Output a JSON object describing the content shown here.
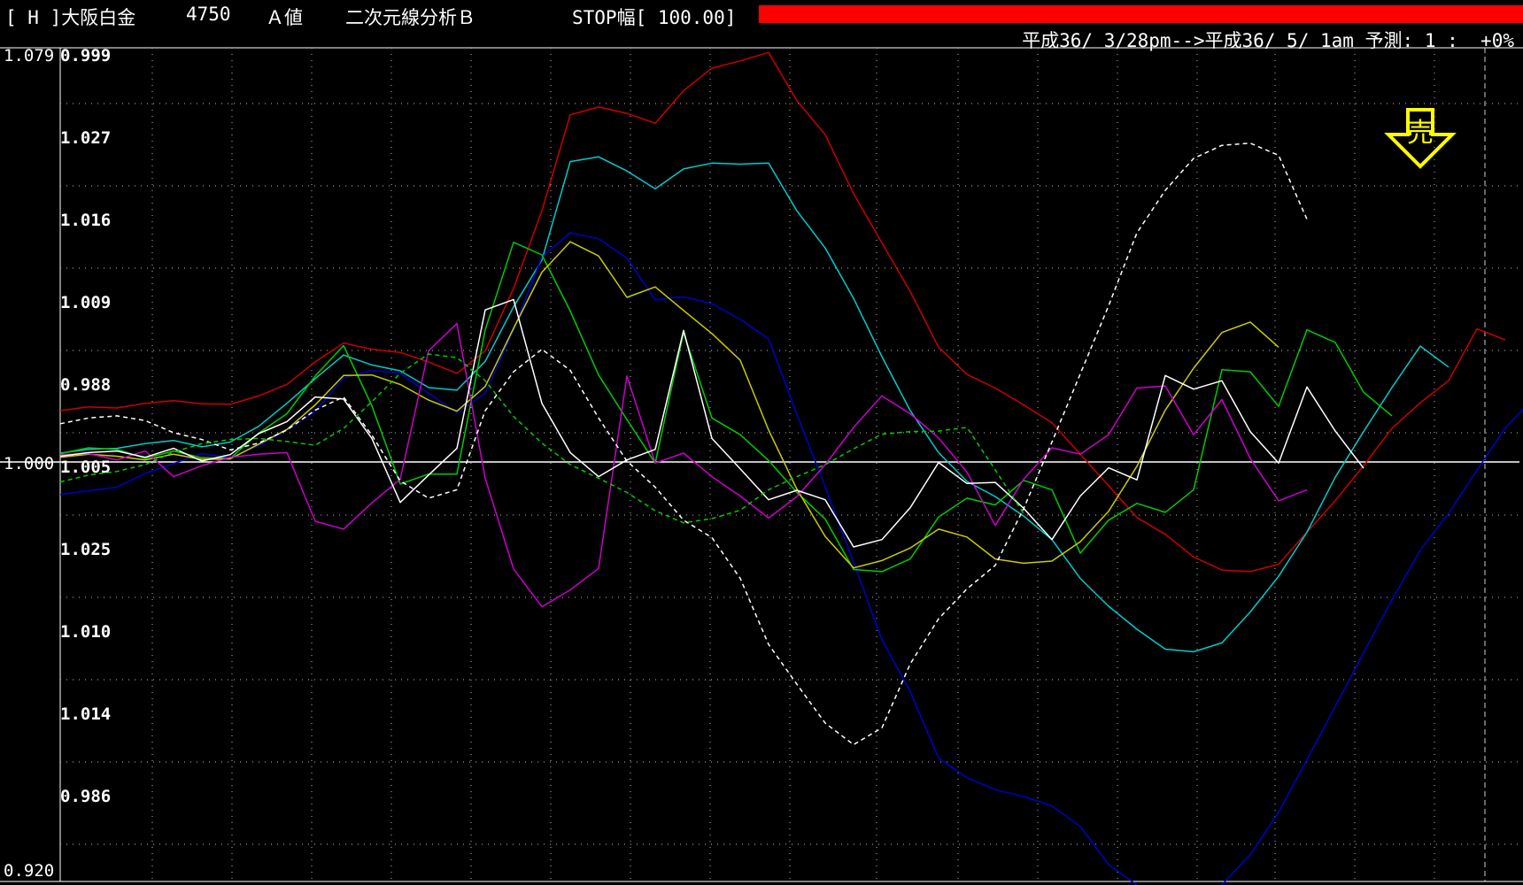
{
  "header": {
    "symbol": "[ H ]大阪白金",
    "price": "4750",
    "mode": "Ａ値",
    "analysis": "二次元線分析Ｂ",
    "stop": "STOP幅[ 100.00]",
    "colors": {
      "stop_bar": "#ff0000"
    }
  },
  "subheader": {
    "period": "平成36/ 3/28pm-->平成36/ 5/ 1am 予測: 1 :  +0%"
  },
  "chart_data": {
    "type": "line",
    "left_axis": {
      "top": "1.079",
      "mid": "1.000",
      "bottom": "0.920"
    },
    "right_labels": [
      "0.999",
      "1.027",
      "1.016",
      "1.009",
      "0.988",
      "1.005",
      "1.025",
      "1.010",
      "1.014",
      "0.986"
    ],
    "signal": {
      "glyph": "売",
      "meaning": "sell",
      "color": "#ffff00"
    },
    "baseline": 1.0,
    "y_range": [
      0.92,
      1.079
    ],
    "series": [
      {
        "color": "#cc0000",
        "style": "solid",
        "values": [
          1.0098,
          1.0105,
          1.0103,
          1.0112,
          1.0117,
          1.0111,
          1.011,
          1.0126,
          1.0148,
          1.0191,
          1.0227,
          1.0215,
          1.0209,
          1.0191,
          1.0169,
          1.0212,
          1.0331,
          1.0479,
          1.0662,
          1.0677,
          1.0665,
          1.0646,
          1.0708,
          1.0751,
          1.0765,
          1.0781,
          1.0689,
          1.0624,
          1.0512,
          1.0418,
          1.0325,
          1.0219,
          1.0167,
          1.0141,
          1.0109,
          1.0075,
          1.0015,
          0.9955,
          0.9894,
          0.9862,
          0.9819,
          0.9794,
          0.9791,
          0.9805,
          0.9866,
          0.9926,
          0.9993,
          1.0064,
          1.0113,
          1.0155,
          1.0254,
          1.0233
        ]
      },
      {
        "color": "#00cccc",
        "style": "solid",
        "values": [
          1.0017,
          1.0024,
          1.0026,
          1.0035,
          1.0041,
          1.0029,
          1.0038,
          1.0068,
          1.0112,
          1.0159,
          1.0204,
          1.0185,
          1.0174,
          1.0142,
          1.0137,
          1.0192,
          1.0296,
          1.0385,
          1.0573,
          1.0582,
          1.0555,
          1.0521,
          1.0559,
          1.057,
          1.0568,
          1.057,
          1.0479,
          1.0408,
          1.0312,
          1.0201,
          1.0098,
          1.0018,
          0.9963,
          0.9934,
          0.9897,
          0.9852,
          0.9778,
          0.9725,
          0.9681,
          0.9643,
          0.9638,
          0.9655,
          0.9714,
          0.9782,
          0.9866,
          0.9971,
          1.0058,
          1.0142,
          1.0221,
          1.0181
        ]
      },
      {
        "color": "#0000cc",
        "style": "solid",
        "values": [
          0.9938,
          0.9945,
          0.9952,
          0.9978,
          0.9997,
          1.0016,
          1.0008,
          1.0031,
          1.0061,
          1.0097,
          1.016,
          1.0175,
          1.0169,
          1.0131,
          1.0094,
          1.0131,
          1.0252,
          1.0391,
          1.0437,
          1.0426,
          1.0389,
          1.0309,
          1.0315,
          1.0302,
          1.0272,
          1.0235,
          1.0091,
          0.9952,
          0.9809,
          0.9661,
          0.9562,
          0.9435,
          0.9398,
          0.9375,
          0.9362,
          0.9344,
          0.9305,
          0.9232,
          0.9193,
          0.9171,
          0.9163,
          0.9194,
          0.9251,
          0.9332,
          0.9432,
          0.9534,
          0.9636,
          0.9737,
          0.9832,
          0.9902,
          0.9984,
          1.0065,
          1.0121,
          1.0247,
          1.0254
        ]
      },
      {
        "color": "#00cc00",
        "style": "solid",
        "values": [
          1.0016,
          1.0027,
          1.0024,
          1.0007,
          1.0021,
          1.0008,
          1.0007,
          1.0055,
          1.0092,
          1.0164,
          1.0222,
          1.0107,
          0.9958,
          0.9977,
          0.9977,
          1.0252,
          1.0419,
          1.0395,
          1.0288,
          1.0166,
          1.0081,
          0.9998,
          1.0247,
          1.0084,
          1.0052,
          1.0003,
          0.9942,
          0.9891,
          0.9795,
          0.9791,
          0.9815,
          0.9895,
          0.9931,
          0.9918,
          0.9965,
          0.9947,
          0.9826,
          0.9889,
          0.9921,
          0.9904,
          0.9947,
          1.0176,
          1.0172,
          1.0106,
          1.0252,
          1.0228,
          1.0133,
          1.0088
        ]
      },
      {
        "color": "#cccc00",
        "style": "solid",
        "values": [
          1.0009,
          1.0015,
          1.0011,
          1.0004,
          1.0015,
          1.0005,
          1.0006,
          1.0034,
          1.0062,
          1.0109,
          1.0165,
          1.0166,
          1.0148,
          1.0118,
          1.0097,
          1.0144,
          1.0255,
          1.0362,
          1.042,
          1.0393,
          1.0314,
          1.0334,
          1.0289,
          1.0245,
          1.0194,
          1.0061,
          0.9948,
          0.9858,
          0.9798,
          0.9812,
          0.9836,
          0.9872,
          0.9857,
          0.9815,
          0.9807,
          0.9811,
          0.9848,
          0.9906,
          0.9992,
          1.0099,
          1.0179,
          1.0247,
          1.0267,
          1.0219
        ]
      },
      {
        "color": "#cc00cc",
        "style": "solid",
        "values": [
          1.0014,
          1.0016,
          1.0004,
          1.0021,
          0.9972,
          0.9993,
          1.0009,
          1.0015,
          1.0018,
          0.9887,
          0.9872,
          0.9922,
          0.9967,
          1.0212,
          1.0264,
          0.9969,
          0.9796,
          0.9724,
          0.9756,
          0.9797,
          1.0164,
          0.9998,
          1.0017,
          0.9972,
          0.9935,
          0.9893,
          0.9934,
          0.9995,
          1.0066,
          1.0126,
          1.0092,
          1.0046,
          0.9981,
          0.9879,
          0.9967,
          1.0027,
          1.0015,
          1.0052,
          1.0141,
          1.0145,
          1.0052,
          1.0119,
          1.0007,
          0.9926,
          0.9947
        ]
      },
      {
        "color": "#ffffff",
        "style": "solid",
        "values": [
          1.0011,
          1.0018,
          1.0021,
          1.0009,
          1.0026,
          1.0002,
          1.0014,
          1.0054,
          1.0077,
          1.0124,
          1.012,
          1.0045,
          0.9923,
          0.9975,
          1.0026,
          1.029,
          1.031,
          1.0112,
          1.0018,
          0.9972,
          1.0004,
          1.0024,
          1.0251,
          1.0045,
          0.9987,
          0.9928,
          0.9946,
          0.9928,
          0.9838,
          0.9852,
          0.9913,
          0.9999,
          0.9959,
          0.9961,
          0.9912,
          0.9852,
          0.9935,
          0.9989,
          0.9966,
          1.0165,
          1.0139,
          1.0155,
          1.0058,
          0.9998,
          1.0143,
          1.0059,
          0.9988
        ]
      },
      {
        "color": "#ffffff",
        "style": "dashed",
        "values": [
          1.0073,
          1.0084,
          1.0088,
          1.0079,
          1.0056,
          1.0043,
          1.0023,
          1.0036,
          1.0061,
          1.0099,
          1.0124,
          1.0051,
          0.9964,
          0.9931,
          0.9947,
          1.0098,
          1.0172,
          1.0215,
          1.0175,
          1.0084,
          1.0002,
          0.9952,
          0.9889,
          0.9856,
          0.9778,
          0.9652,
          0.9576,
          0.9502,
          0.9461,
          0.9493,
          0.9615,
          0.9701,
          0.9758,
          0.9803,
          0.9911,
          1.0038,
          1.0168,
          1.0298,
          1.0437,
          1.0518,
          1.0579,
          1.0604,
          1.0608,
          1.0585,
          1.0463
        ]
      },
      {
        "color": "#00cc00",
        "style": "dashed",
        "values": [
          0.9962,
          0.9975,
          0.9982,
          0.9995,
          1.0019,
          1.0035,
          1.0043,
          1.0045,
          1.0039,
          1.0032,
          1.0064,
          1.0115,
          1.0169,
          1.0206,
          1.0199,
          1.0155,
          1.0087,
          1.0036,
          0.9995,
          0.9969,
          0.9942,
          0.9907,
          0.9884,
          0.9892,
          0.9908,
          0.9947,
          0.9972,
          0.9995,
          1.0025,
          1.0053,
          1.0058,
          1.0059,
          1.0066,
          0.9985,
          0.9902
        ]
      }
    ]
  }
}
